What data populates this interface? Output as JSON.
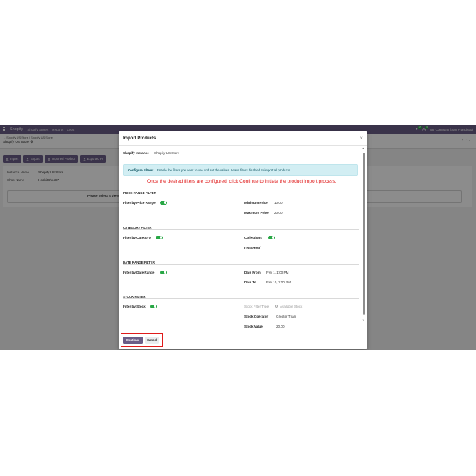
{
  "navbar": {
    "app_name": "Shopify",
    "menu": [
      "Shopify Stores",
      "Reports",
      "Logs"
    ],
    "chat_count": "15",
    "activity_count": "24",
    "company": "My Company (San Francisco)"
  },
  "control_panel": {
    "breadcrumb": "Shopify US Store / Shopify US Store",
    "title": "Shopify US Store",
    "pager": "1 / 1"
  },
  "toolbar": {
    "buttons": [
      "Import",
      "Export",
      "Imported Product",
      "Exported Pr"
    ]
  },
  "sheet": {
    "instance_label": "Instance Name",
    "instance_value": "Shopify US Store",
    "shop_label": "Shop Name",
    "shop_value": "HobbitShoe87",
    "message": "Please select a view"
  },
  "modal": {
    "title": "Import Products",
    "shopify_instance_label": "Shopify Instance",
    "shopify_instance_value": "Shopify US Store",
    "info_strong": "Configure Filters:",
    "info_text": "Enable the filters you want to use and set the values. Leave filters disabled to import all products.",
    "annotation": "Once the desired filters are configured, click Continue to initiate the product import process.",
    "price_section": "PRICE RANGE FILTER",
    "filter_price_label": "Filter by Price Range",
    "min_price_label": "Minimum Price",
    "min_price_value": "10.00",
    "max_price_label": "Maximum Price",
    "max_price_value": "20.00",
    "category_section": "CATEGORY FILTER",
    "filter_category_label": "Filter by Category",
    "collections_label": "Collections",
    "collection_label": "Collection",
    "collection_help": "?",
    "date_section": "DATE RANGE FILTER",
    "filter_date_label": "Filter by Date Range",
    "date_from_label": "Date From",
    "date_from_value": "Feb 1, 1:00 PM",
    "date_to_label": "Date To",
    "date_to_value": "Feb 10, 1:00 PM",
    "stock_section": "STOCK FILTER",
    "filter_stock_label": "Filter by Stock",
    "stock_type_label": "Stock Filter Type",
    "stock_type_value": "Available Stock",
    "stock_operator_label": "Stock Operator",
    "stock_operator_value": "Greater Than",
    "stock_value_label": "Stock Value",
    "stock_value_value": "20.00",
    "continue_label": "Continue",
    "cancel_label": "Cancel"
  },
  "colors": {
    "brand": "#6b5d87",
    "toggle_on": "#28a745",
    "annotation": "#e01b1b",
    "info_bg": "#d2eef3"
  }
}
